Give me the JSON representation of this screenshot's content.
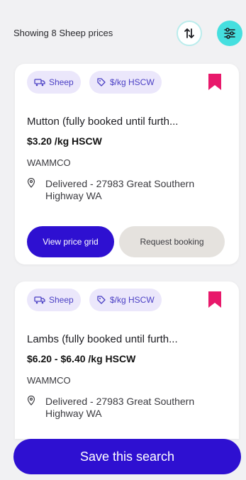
{
  "header": {
    "count_text": "Showing 8 Sheep prices"
  },
  "listings": [
    {
      "chips": [
        "Sheep",
        "$/kg HSCW"
      ],
      "title": "Mutton (fully booked until furth...",
      "price": "$3.20 /kg HSCW",
      "company": "WAMMCO",
      "delivery": "Delivered - 27983 Great Southern Highway WA",
      "primary_button": "View price grid",
      "secondary_button": "Request booking"
    },
    {
      "chips": [
        "Sheep",
        "$/kg HSCW"
      ],
      "title": "Lambs (fully booked until furth...",
      "price": "$6.20 - $6.40 /kg HSCW",
      "company": "WAMMCO",
      "delivery": "Delivered - 27983 Great Southern Highway WA"
    }
  ],
  "save_search_label": "Save this search",
  "colors": {
    "primary": "#2e10d1",
    "accent": "#45dfdf",
    "bookmark": "#e8196b",
    "chip_bg": "#ebe7fb"
  },
  "icons": {
    "sort": "sort-arrows-icon",
    "filter": "filter-sliders-icon",
    "chip1": "truck-icon",
    "chip2": "tag-icon",
    "bookmark": "bookmark-icon",
    "location": "location-pin-icon"
  }
}
